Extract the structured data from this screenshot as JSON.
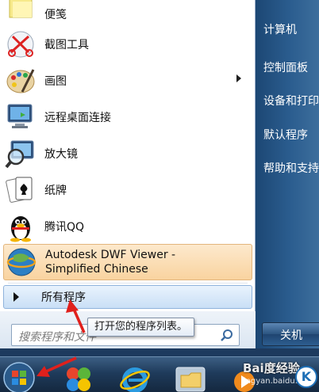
{
  "programs": [
    {
      "label": "便笺",
      "icon": "sticky-notes-icon"
    },
    {
      "label": "截图工具",
      "icon": "snipping-tool-icon"
    },
    {
      "label": "画图",
      "icon": "paint-icon",
      "submenu": true
    },
    {
      "label": "远程桌面连接",
      "icon": "remote-desktop-icon"
    },
    {
      "label": "放大镜",
      "icon": "magnifier-icon"
    },
    {
      "label": "纸牌",
      "icon": "solitaire-icon"
    },
    {
      "label": "腾讯QQ",
      "icon": "qq-penguin-icon"
    },
    {
      "label_line1": "Autodesk DWF Viewer -",
      "label_line2": "Simplified Chinese",
      "icon": "autodesk-globe-icon",
      "highlighted": true
    }
  ],
  "all_programs": {
    "label": "所有程序"
  },
  "tooltip": {
    "text": "打开您的程序列表。"
  },
  "search": {
    "placeholder": "搜索程序和文件",
    "icon": "search-icon"
  },
  "right_links": [
    {
      "label": "计算机"
    },
    {
      "label": "控制面板"
    },
    {
      "label": "设备和打印机"
    },
    {
      "label": "默认程序"
    },
    {
      "label": "帮助和支持"
    }
  ],
  "shutdown": {
    "label": "关机"
  },
  "taskbar": {
    "items": [
      "start-orb-icon",
      "media-center-icon",
      "internet-explorer-icon",
      "windows-explorer-icon",
      "media-player-icon"
    ]
  },
  "watermark": {
    "text": "Bai度经验",
    "sub": "jingyan.baidu.com",
    "k_logo": "K"
  },
  "colors": {
    "highlight": "#f9d39f",
    "all_programs_bg": "#c9dff6",
    "right_pane": "#2b5d8f",
    "annotation_arrow": "#e0201c"
  }
}
